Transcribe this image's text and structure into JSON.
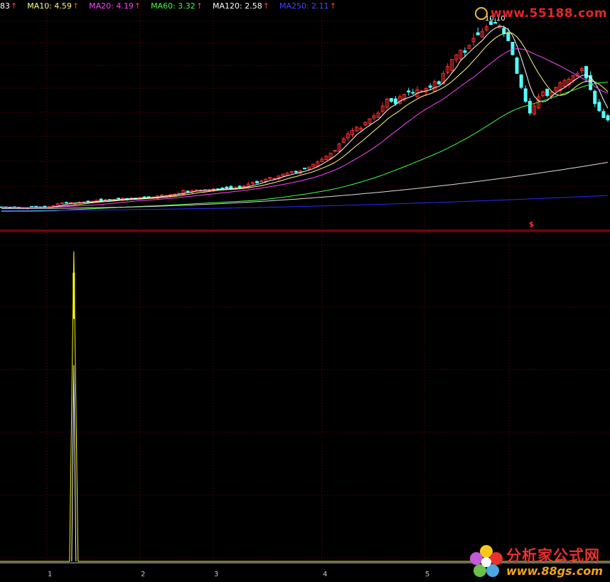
{
  "legend": [
    {
      "label": "83",
      "color": "#ffffff"
    },
    {
      "label": "MA10: 4.59",
      "color": "#ffff80"
    },
    {
      "label": "MA20: 4.19",
      "color": "#ff44ff"
    },
    {
      "label": "MA60: 3.32",
      "color": "#44ff44"
    },
    {
      "label": "MA120: 2.58",
      "color": "#ffffff"
    },
    {
      "label": "MA250: 2.11",
      "color": "#4444ff"
    }
  ],
  "legend_arrow": "↑",
  "peak_label": "10.10",
  "signal_mark": "$",
  "watermarks": {
    "top": "www.55188.com",
    "bottom_cn": "分析家公式网",
    "bottom_url": "www.88gs.com"
  },
  "x_ticks": [
    "1",
    "2",
    "3",
    "4",
    "5"
  ],
  "colors": {
    "up": "#ff3232",
    "down": "#54ffff",
    "ma5": "#ffffff",
    "ma10": "#ffff80",
    "ma20": "#ff44ff",
    "ma60": "#44ff44",
    "ma120": "#dcdcdc",
    "ma250": "#2a2aff",
    "grid": "#7a0000",
    "signal": "#ffff00"
  },
  "chart_data": [
    {
      "type": "candlestick",
      "title": "",
      "series_close": [
        2.05,
        2.05,
        2.04,
        2.05,
        2.04,
        2.04,
        2.04,
        2.05,
        2.05,
        2.05,
        2.04,
        2.08,
        2.12,
        2.2,
        2.25,
        2.24,
        2.26,
        2.23,
        2.26,
        2.28,
        2.3,
        2.32,
        2.36,
        2.32,
        2.38,
        2.36,
        2.4,
        2.42,
        2.44,
        2.4,
        2.45,
        2.43,
        2.47,
        2.46,
        2.48,
        2.5,
        2.54,
        2.58,
        2.56,
        2.6,
        2.62,
        2.66,
        2.78,
        2.72,
        2.76,
        2.8,
        2.78,
        2.82,
        2.8,
        2.84,
        2.82,
        2.86,
        2.88,
        2.85,
        2.9,
        2.92,
        2.96,
        3.05,
        3.12,
        3.1,
        3.18,
        3.26,
        3.34,
        3.3,
        3.4,
        3.48,
        3.52,
        3.58,
        3.56,
        3.62,
        3.7,
        3.78,
        3.9,
        4.0,
        4.12,
        4.25,
        4.38,
        4.5,
        4.78,
        5.0,
        5.2,
        5.35,
        5.5,
        5.45,
        5.7,
        5.85,
        5.98,
        6.1,
        6.4,
        6.7,
        6.6,
        6.5,
        6.8,
        6.9,
        7.0,
        6.95,
        7.1,
        7.05,
        7.15,
        7.2,
        7.45,
        7.35,
        7.8,
        8.1,
        8.4,
        8.6,
        8.8,
        8.7,
        9.0,
        9.3,
        9.45,
        9.6,
        9.8,
        9.9,
        9.95,
        9.85,
        9.5,
        9.2,
        8.6,
        7.8,
        7.2,
        6.6,
        6.1,
        6.4,
        6.8,
        7.0,
        6.85,
        7.0,
        7.2,
        7.4,
        7.5,
        7.55,
        7.7,
        7.8,
        8.0,
        7.6,
        7.1,
        6.5,
        6.2,
        5.9,
        5.8
      ],
      "ma10_last": 4.59,
      "ma20_last": 4.19,
      "ma60_last": 3.32,
      "ma120_last": 2.58,
      "ma250_last": 2.11,
      "peak_high": 10.1,
      "ylim": [
        1.8,
        10.4
      ]
    },
    {
      "type": "line",
      "title": "",
      "signal_index": 9,
      "signal_value": 1,
      "ylim": [
        0,
        1.02
      ]
    }
  ]
}
